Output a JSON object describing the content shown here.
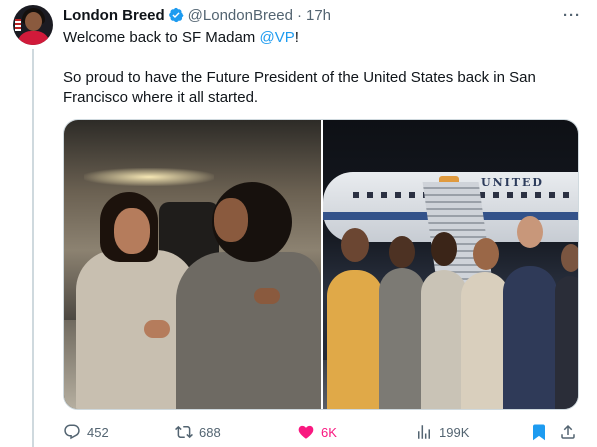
{
  "author": {
    "name": "London Breed",
    "handle": "@LondonBreed",
    "separator": "·",
    "time": "17h",
    "verified": true
  },
  "more_label": "···",
  "tweet": {
    "line1_prefix": "Welcome back to SF Madam ",
    "line1_mention": "@VP",
    "line1_suffix": "!",
    "paragraph2": "So proud to have the Future President of the United States back in San Francisco where it all started."
  },
  "media": {
    "photo2_sign": "UNITED"
  },
  "actions": {
    "replies": "452",
    "reposts": "688",
    "likes": "6K",
    "views": "199K"
  },
  "colors": {
    "accent": "#1d9bf0",
    "like": "#f91880",
    "muted": "#536471",
    "text": "#0f1419"
  },
  "icons": [
    "reply-icon",
    "repost-icon",
    "heart-icon",
    "views-icon",
    "bookmark-icon",
    "share-icon",
    "verified-badge-icon",
    "more-icon"
  ]
}
